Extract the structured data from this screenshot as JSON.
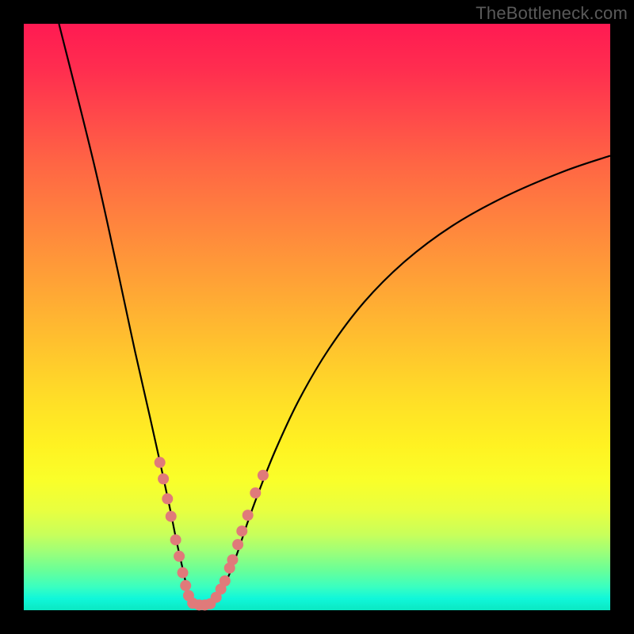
{
  "attribution": {
    "text": "TheBottleneck.com"
  },
  "chart_data": {
    "type": "line",
    "title": "",
    "xlabel": "",
    "ylabel": "",
    "xlim": [
      0,
      100
    ],
    "ylim": [
      0,
      100
    ],
    "grid": false,
    "series": [
      {
        "name": "bottleneck-curve",
        "path_points": [
          [
            6,
            100
          ],
          [
            12,
            76
          ],
          [
            16,
            58
          ],
          [
            19,
            44
          ],
          [
            21.5,
            33
          ],
          [
            23.5,
            24
          ],
          [
            25,
            17
          ],
          [
            26,
            12
          ],
          [
            27,
            7.5
          ],
          [
            27.8,
            4
          ],
          [
            28.5,
            1.8
          ],
          [
            29,
            1
          ],
          [
            30,
            0.8
          ],
          [
            31,
            0.9
          ],
          [
            32,
            1.2
          ],
          [
            33.5,
            3
          ],
          [
            35,
            6
          ],
          [
            36.5,
            10
          ],
          [
            38,
            14.5
          ],
          [
            40,
            20
          ],
          [
            43,
            27.5
          ],
          [
            47,
            36
          ],
          [
            52,
            44.5
          ],
          [
            58,
            52.5
          ],
          [
            65,
            59.5
          ],
          [
            73,
            65.5
          ],
          [
            82,
            70.5
          ],
          [
            92,
            74.8
          ],
          [
            100,
            77.5
          ]
        ],
        "markers": [
          [
            23.2,
            25.2
          ],
          [
            23.8,
            22.4
          ],
          [
            24.5,
            19.0
          ],
          [
            25.1,
            16.0
          ],
          [
            25.9,
            12.0
          ],
          [
            26.5,
            9.2
          ],
          [
            27.1,
            6.4
          ],
          [
            27.6,
            4.2
          ],
          [
            28.1,
            2.5
          ],
          [
            28.8,
            1.2
          ],
          [
            29.9,
            0.9
          ],
          [
            30.9,
            0.9
          ],
          [
            31.8,
            1.1
          ],
          [
            32.8,
            2.2
          ],
          [
            33.6,
            3.6
          ],
          [
            34.3,
            5.0
          ],
          [
            35.1,
            7.2
          ],
          [
            35.6,
            8.6
          ],
          [
            36.5,
            11.2
          ],
          [
            37.2,
            13.5
          ],
          [
            38.2,
            16.2
          ],
          [
            39.5,
            20.0
          ],
          [
            40.8,
            23.0
          ]
        ]
      }
    ],
    "background": {
      "type": "vertical-gradient",
      "stops": [
        {
          "pos": 0.0,
          "color": "#ff1a52"
        },
        {
          "pos": 0.5,
          "color": "#ffc020"
        },
        {
          "pos": 0.75,
          "color": "#fff222"
        },
        {
          "pos": 0.95,
          "color": "#40ffb0"
        },
        {
          "pos": 1.0,
          "color": "#0be8c2"
        }
      ]
    }
  }
}
